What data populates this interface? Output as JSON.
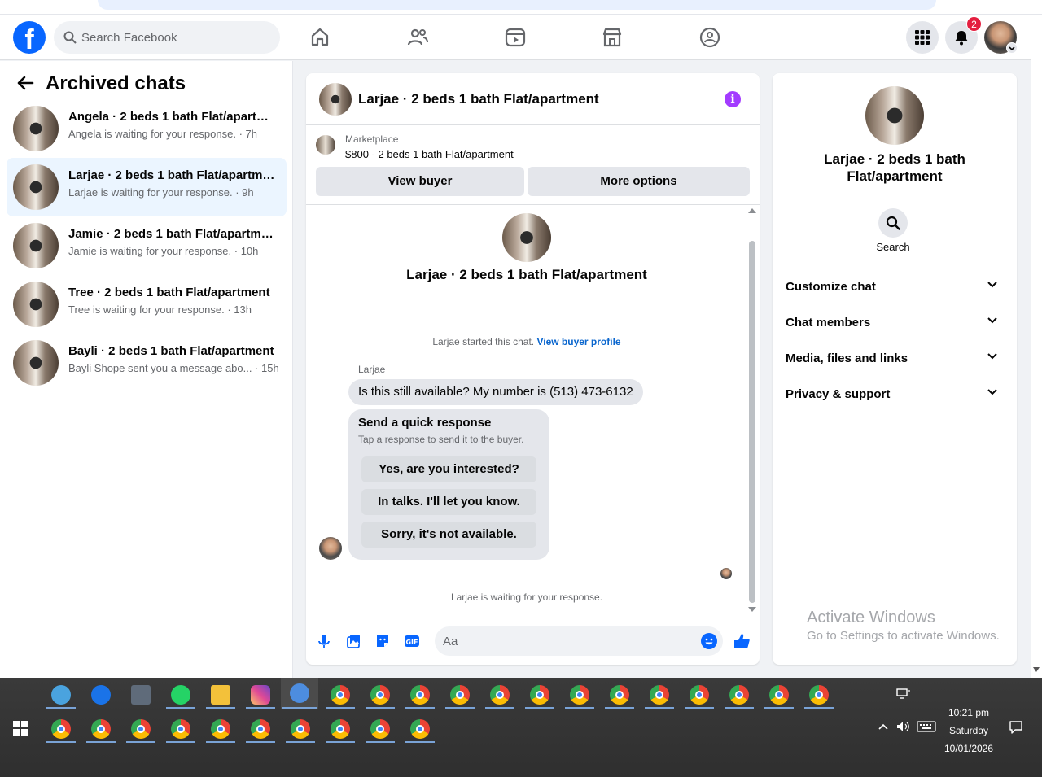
{
  "navbar": {
    "search_placeholder": "Search Facebook",
    "notification_count": "2"
  },
  "sidebar": {
    "title": "Archived chats",
    "chats": [
      {
        "name": "Angela · 2 beds 1 bath Flat/apartm...",
        "preview": "Angela is waiting for your response.",
        "time": " · 7h",
        "active": false
      },
      {
        "name": "Larjae · 2 beds 1 bath Flat/apartme...",
        "preview": "Larjae is waiting for your response.",
        "time": " · 9h",
        "active": true
      },
      {
        "name": "Jamie · 2 beds 1 bath Flat/apartment",
        "preview": "Jamie is waiting for your response.",
        "time": " · 10h",
        "active": false
      },
      {
        "name": "Tree · 2 beds 1 bath Flat/apartment",
        "preview": "Tree is waiting for your response.",
        "time": " · 13h",
        "active": false
      },
      {
        "name": "Bayli · 2 beds 1 bath Flat/apartment",
        "preview": "Bayli Shope sent you a message abo...",
        "time": " · 15h",
        "active": false
      }
    ]
  },
  "conversation": {
    "title": "Larjae · 2 beds 1 bath Flat/apartment",
    "marketplace_label": "Marketplace",
    "listing": "$800 - 2 beds 1 bath Flat/apartment",
    "view_buyer": "View buyer",
    "more_options": "More options",
    "started_text": "Larjae started this chat. ",
    "view_buyer_profile": "View buyer profile",
    "sender": "Larjae",
    "message": "Is this still available? My number is (513) 473-6132",
    "quick_response_title": "Send a quick response",
    "quick_response_sub": "Tap a response to send it to the buyer.",
    "quick_responses": [
      "Yes, are you interested?",
      "In talks. I'll let you know.",
      "Sorry, it's not available."
    ],
    "waiting": "Larjae is waiting for your response.",
    "composer_placeholder": "Aa"
  },
  "details": {
    "title": "Larjae · 2 beds 1 bath Flat/apartment",
    "search_label": "Search",
    "sections": [
      "Customize chat",
      "Chat members",
      "Media, files and links",
      "Privacy & support"
    ]
  },
  "watermark": {
    "line1": "Activate Windows",
    "line2": "Go to Settings to activate Windows."
  },
  "taskbar": {
    "time": "10:21 pm",
    "day": "Saturday",
    "date": "10/01/2026"
  },
  "colors": {
    "brand": "#0866ff",
    "active_chat": "#ebf5ff",
    "info": "#a33bff",
    "badge": "#e41e3f"
  }
}
